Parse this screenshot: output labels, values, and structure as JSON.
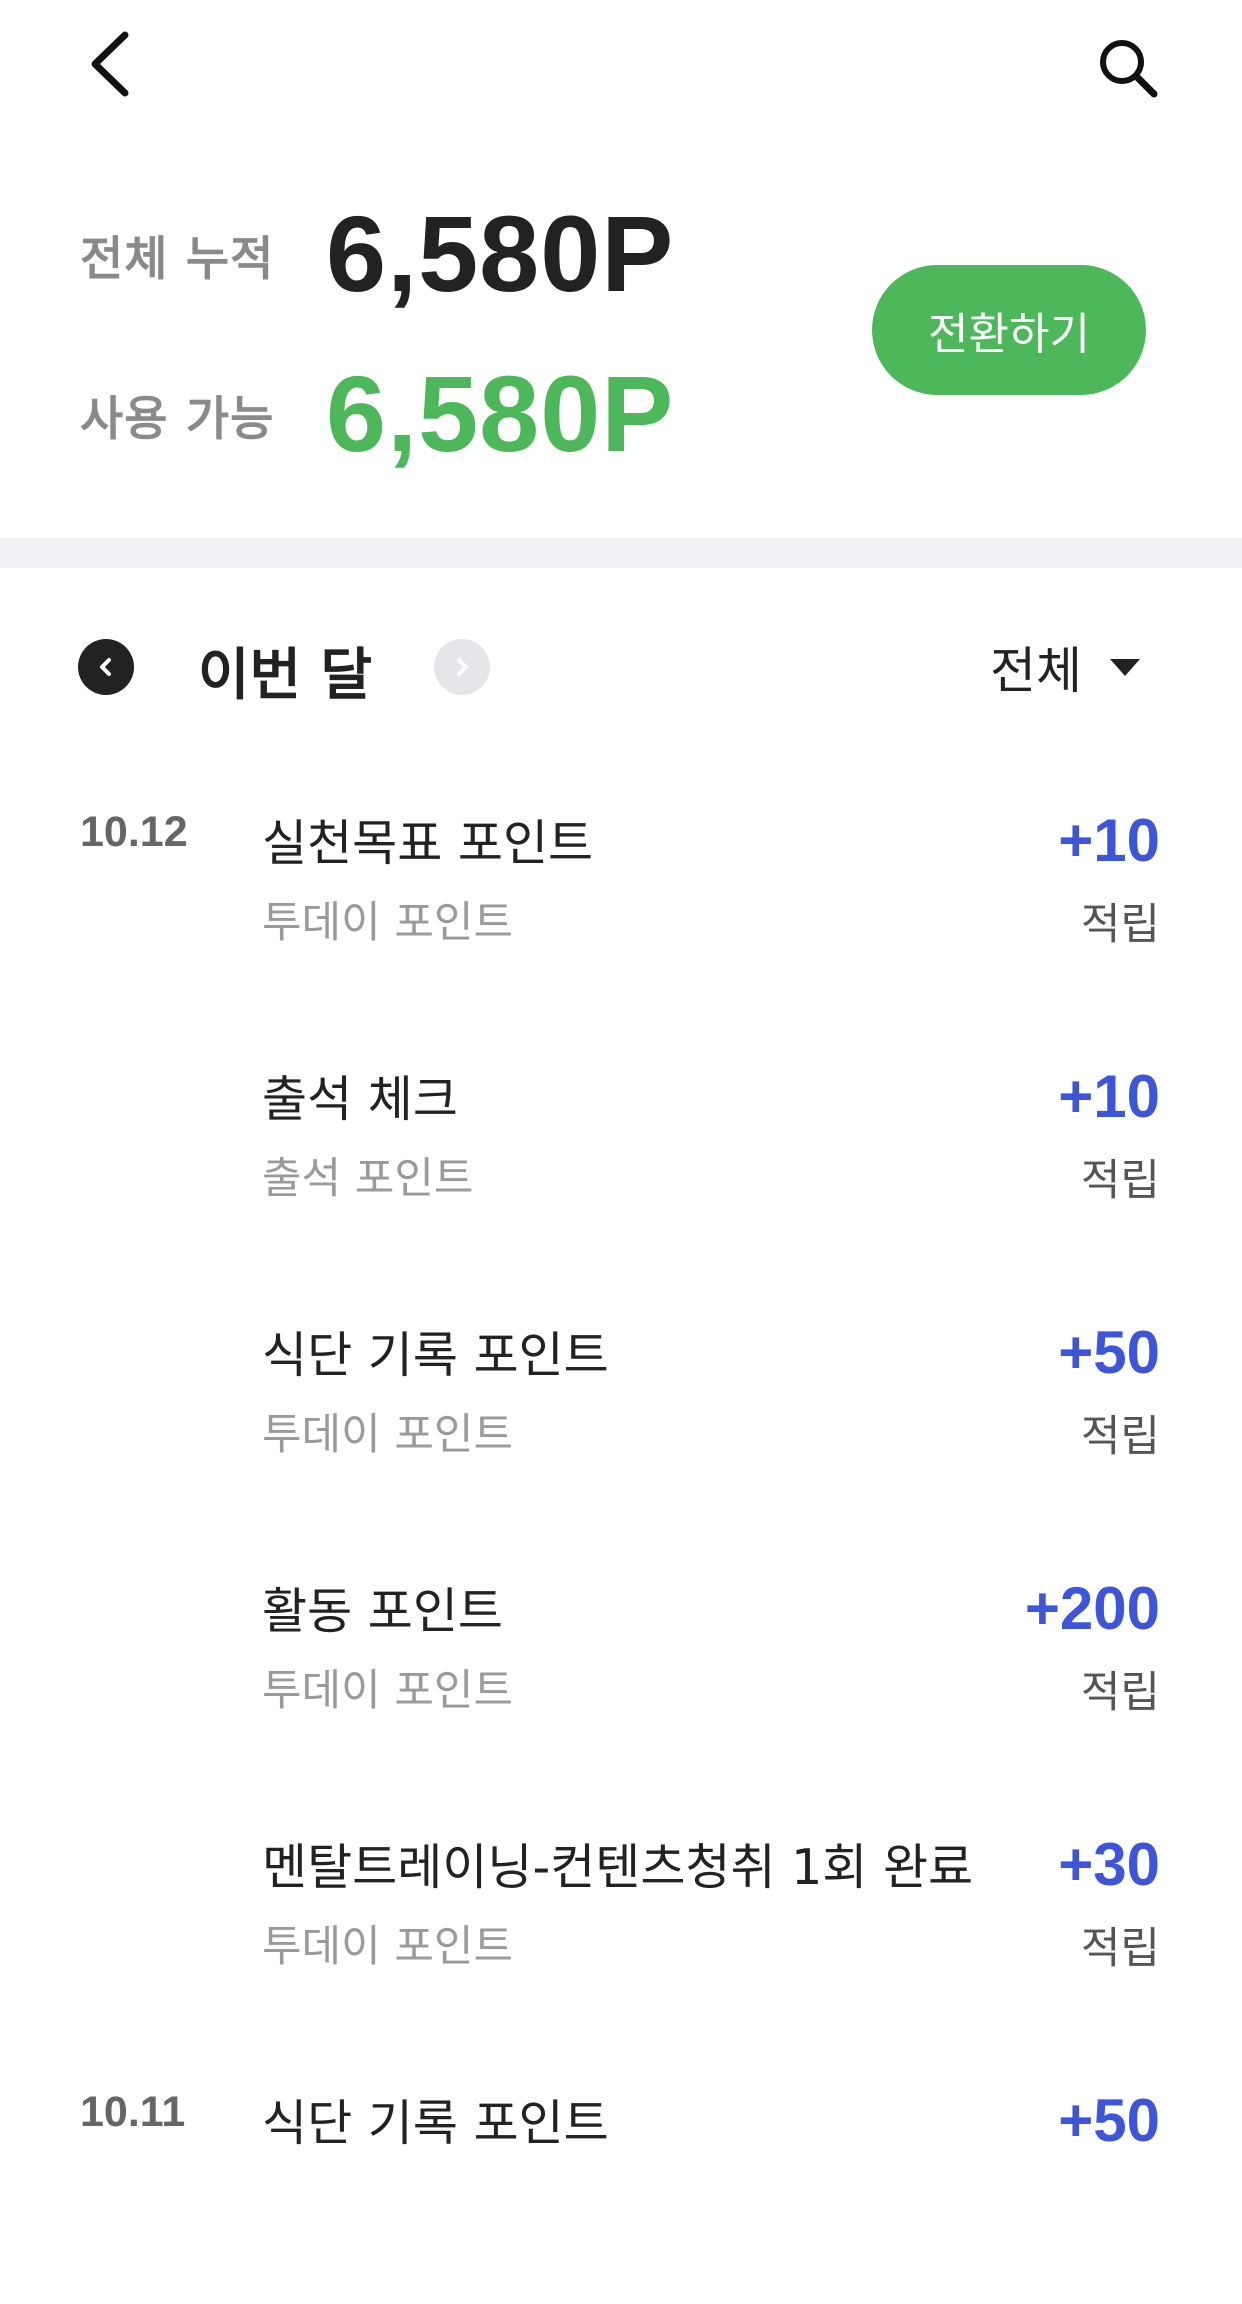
{
  "nav": {
    "back_icon": "chevron-left-icon",
    "search_icon": "search-icon"
  },
  "summary": {
    "total_label": "전체 누적",
    "total_value": "6,580P",
    "available_label": "사용 가능",
    "available_value": "6,580P",
    "convert_label": "전환하기",
    "accent_color": "#4cb85a"
  },
  "month_selector": {
    "label": "이번 달",
    "filter_label": "전체"
  },
  "colors": {
    "earn_amount": "#3d56d9",
    "divider": "#f1f1f5"
  },
  "entries": [
    {
      "date": "10.12",
      "title": "실천목표 포인트",
      "subtitle": "투데이 포인트",
      "amount": "+10",
      "type": "적립"
    },
    {
      "date": "",
      "title": "출석 체크",
      "subtitle": "출석 포인트",
      "amount": "+10",
      "type": "적립"
    },
    {
      "date": "",
      "title": "식단 기록 포인트",
      "subtitle": "투데이 포인트",
      "amount": "+50",
      "type": "적립"
    },
    {
      "date": "",
      "title": "활동 포인트",
      "subtitle": "투데이 포인트",
      "amount": "+200",
      "type": "적립"
    },
    {
      "date": "",
      "title": "멘탈트레이닝-컨텐츠청취 1회 완료",
      "subtitle": "투데이 포인트",
      "amount": "+30",
      "type": "적립"
    },
    {
      "date": "10.11",
      "title": "식단 기록 포인트",
      "subtitle": "",
      "amount": "+50",
      "type": ""
    }
  ]
}
